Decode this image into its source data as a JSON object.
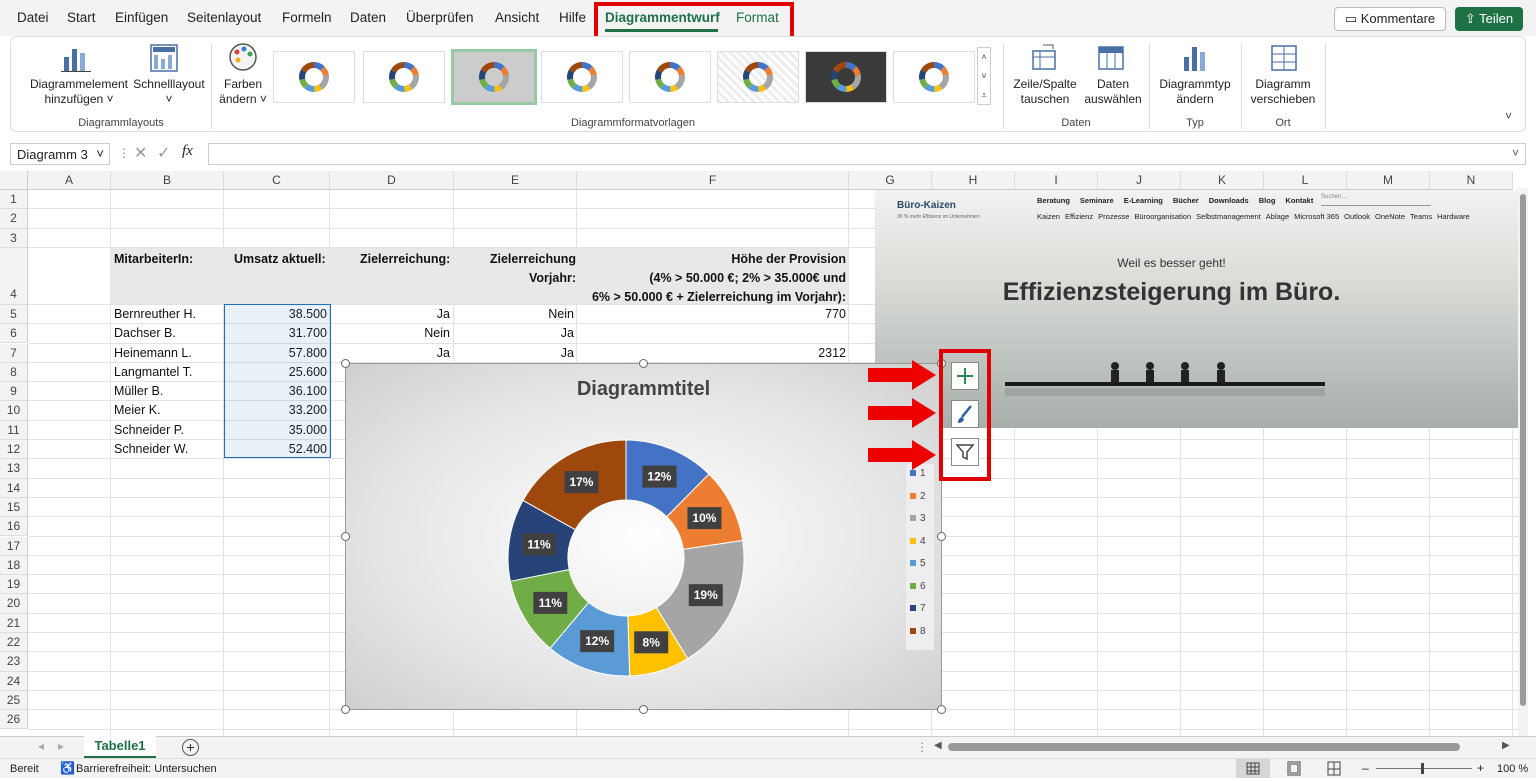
{
  "menu": {
    "items": [
      "Datei",
      "Start",
      "Einfügen",
      "Seitenlayout",
      "Formeln",
      "Daten",
      "Überprüfen",
      "Ansicht",
      "Hilfe"
    ],
    "active_tab": "Diagrammentwurf",
    "context_tab": "Format",
    "comments_label": "Kommentare",
    "share_label": "Teilen"
  },
  "ribbon": {
    "add_element": [
      "Diagrammelement",
      "hinzufügen ˅"
    ],
    "quick_layout": [
      "Schnelllayout",
      "˅"
    ],
    "colors": [
      "Farben",
      "ändern ˅"
    ],
    "switch_rowcol": [
      "Zeile/Spalte",
      "tauschen"
    ],
    "select_data": [
      "Daten",
      "auswählen"
    ],
    "change_type": [
      "Diagrammtyp",
      "ändern"
    ],
    "move_chart": [
      "Diagramm",
      "verschieben"
    ],
    "groups": {
      "layouts": "Diagrammlayouts",
      "styles": "Diagrammformatvorlagen",
      "data": "Daten",
      "type": "Typ",
      "location": "Ort"
    }
  },
  "formula_bar": {
    "name_box": "Diagramm 3",
    "fx": "fx"
  },
  "columns": [
    "A",
    "B",
    "C",
    "D",
    "E",
    "F",
    "G",
    "H",
    "I",
    "J",
    "K",
    "L",
    "M",
    "N"
  ],
  "rows": [
    "1",
    "2",
    "3",
    "4",
    "5",
    "6",
    "7",
    "8",
    "9",
    "10",
    "11",
    "12",
    "13",
    "14",
    "15",
    "16",
    "17",
    "18",
    "19",
    "20",
    "21",
    "22",
    "23",
    "24",
    "25",
    "26"
  ],
  "table": {
    "headers": {
      "employee": "MitarbeiterIn:",
      "revenue": "Umsatz aktuell:",
      "target": "Zielerreichung:",
      "target_prev": [
        "Zielerreichung",
        "Vorjahr:"
      ],
      "commission": [
        "Höhe der Provision",
        "(4% > 50.000 €; 2% > 35.000€ und",
        "6% > 50.000 € + Zielerreichung im Vorjahr):"
      ]
    },
    "rows": [
      {
        "name": "Bernreuther H.",
        "revenue": "38.500",
        "target": "Ja",
        "prev": "Nein",
        "commission": "770"
      },
      {
        "name": "Dachser B.",
        "revenue": "31.700",
        "target": "Nein",
        "prev": "Ja",
        "commission": ""
      },
      {
        "name": "Heinemann L.",
        "revenue": "57.800",
        "target": "Ja",
        "prev": "Ja",
        "commission": "2312"
      },
      {
        "name": "Langmantel T.",
        "revenue": "25.600",
        "target": "",
        "prev": "",
        "commission": ""
      },
      {
        "name": "Müller B.",
        "revenue": "36.100",
        "target": "",
        "prev": "",
        "commission": ""
      },
      {
        "name": "Meier K.",
        "revenue": "33.200",
        "target": "",
        "prev": "",
        "commission": ""
      },
      {
        "name": "Schneider P.",
        "revenue": "35.000",
        "target": "",
        "prev": "",
        "commission": ""
      },
      {
        "name": "Schneider W.",
        "revenue": "52.400",
        "target": "",
        "prev": "",
        "commission": ""
      }
    ]
  },
  "banner": {
    "logo": "Büro-Kaizen",
    "logo_sub": "30 % mehr Effizienz im Unternehmen",
    "nav_top": [
      "Beratung",
      "Seminare",
      "E-Learning",
      "Bücher",
      "Downloads",
      "Blog",
      "Kontakt"
    ],
    "search_placeholder": "Suchen ...",
    "nav_bottom": [
      "Kaizen",
      "Effizienz",
      "Prozesse",
      "Büroorganisation",
      "Selbstmanagement",
      "Ablage",
      "Microsoft 365",
      "Outlook",
      "OneNote",
      "Teams",
      "Hardware"
    ],
    "tagline": "Weil es besser geht!",
    "headline": "Effizienzsteigerung im Büro."
  },
  "chart_data": {
    "type": "pie",
    "variant": "doughnut",
    "title": "Diagrammtitel",
    "categories": [
      "1",
      "2",
      "3",
      "4",
      "5",
      "6",
      "7",
      "8"
    ],
    "values": [
      38500,
      31700,
      57800,
      25600,
      36100,
      33200,
      35000,
      52400
    ],
    "data_labels": [
      "12%",
      "10%",
      "19%",
      "8%",
      "12%",
      "11%",
      "11%",
      "17%"
    ],
    "colors": [
      "#4472c4",
      "#ed7d31",
      "#a5a5a5",
      "#ffc000",
      "#5b9bd5",
      "#70ad47",
      "#264478",
      "#9e480e"
    ],
    "legend": "right"
  },
  "sheet_tab": "Tabelle1",
  "status": {
    "ready": "Bereit",
    "accessibility": "Barrierefreiheit: Untersuchen",
    "zoom": "100 %"
  }
}
